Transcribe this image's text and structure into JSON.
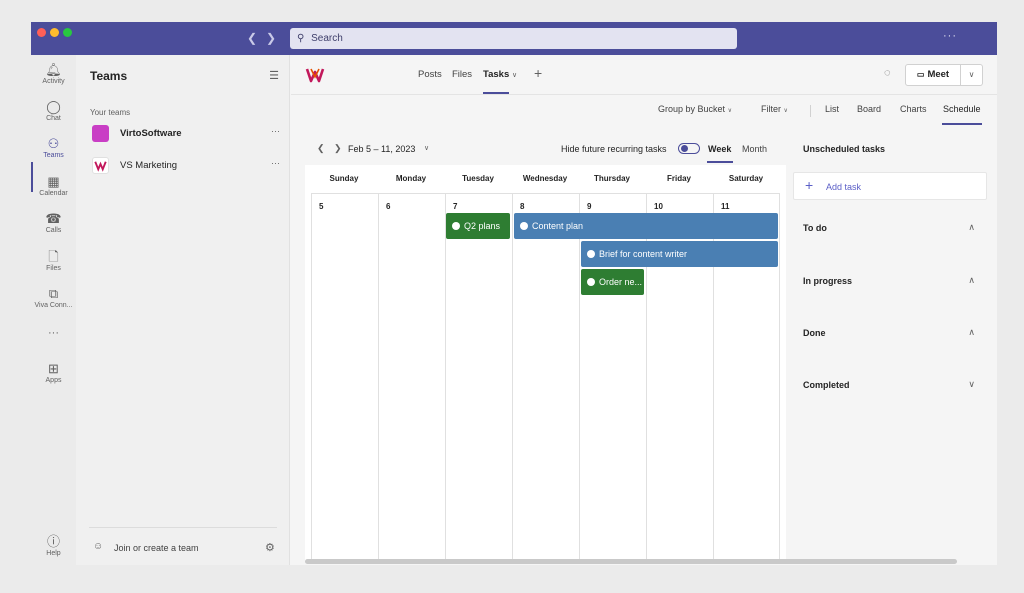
{
  "app": {
    "search_placeholder": "Search",
    "more": "···",
    "accent": "#4b4d9a"
  },
  "rail": {
    "items": [
      {
        "label": "Activity",
        "icon": "bell-icon"
      },
      {
        "label": "Chat",
        "icon": "chat-icon"
      },
      {
        "label": "Teams",
        "icon": "teams-icon"
      },
      {
        "label": "Calendar",
        "icon": "calendar-icon"
      },
      {
        "label": "Calls",
        "icon": "phone-icon"
      },
      {
        "label": "Files",
        "icon": "file-icon"
      },
      {
        "label": "Viva Conn...",
        "icon": "viva-icon"
      },
      {
        "label": "",
        "icon": "more-icon"
      },
      {
        "label": "Apps",
        "icon": "apps-icon"
      },
      {
        "label": "Help",
        "icon": "help-icon"
      }
    ]
  },
  "teams_panel": {
    "title": "Teams",
    "section": "Your teams",
    "teams": [
      {
        "name": "VirtoSoftware",
        "color": "#c93ec5",
        "bold": true
      },
      {
        "name": "VS Marketing",
        "color": "#ffffff",
        "bold": false
      }
    ],
    "team_more": "···",
    "join": "Join or create a team"
  },
  "channel": {
    "tabs": [
      "Posts",
      "Files",
      "Tasks"
    ],
    "active_tab": "Tasks",
    "meet": "Meet"
  },
  "toolbar": {
    "group_by": "Group by Bucket",
    "filter": "Filter",
    "views": [
      "List",
      "Board",
      "Charts",
      "Schedule"
    ],
    "active_view": "Schedule"
  },
  "calendar": {
    "range": "Feb 5 – 11, 2023",
    "hide_recurring": "Hide future recurring tasks",
    "hide_recurring_on": true,
    "week": "Week",
    "month": "Month",
    "days": [
      {
        "name": "Sunday",
        "num": "5"
      },
      {
        "name": "Monday",
        "num": "6"
      },
      {
        "name": "Tuesday",
        "num": "7"
      },
      {
        "name": "Wednesday",
        "num": "8"
      },
      {
        "name": "Thursday",
        "num": "9"
      },
      {
        "name": "Friday",
        "num": "10"
      },
      {
        "name": "Saturday",
        "num": "11"
      }
    ],
    "tasks": [
      {
        "title": "Q2 plans",
        "status": "completed",
        "color": "#2e7d32"
      },
      {
        "title": "Content plan",
        "status": "in-progress",
        "color": "#4a7fb3"
      },
      {
        "title": "Brief for content writer",
        "status": "in-progress",
        "color": "#4a7fb3"
      },
      {
        "title": "Order ne...",
        "status": "completed",
        "color": "#2e7d32"
      }
    ]
  },
  "unscheduled": {
    "title": "Unscheduled tasks",
    "add_task": "Add task",
    "groups": [
      {
        "label": "To do",
        "expanded": true
      },
      {
        "label": "In progress",
        "expanded": true
      },
      {
        "label": "Done",
        "expanded": true
      },
      {
        "label": "Completed",
        "expanded": false
      }
    ]
  }
}
